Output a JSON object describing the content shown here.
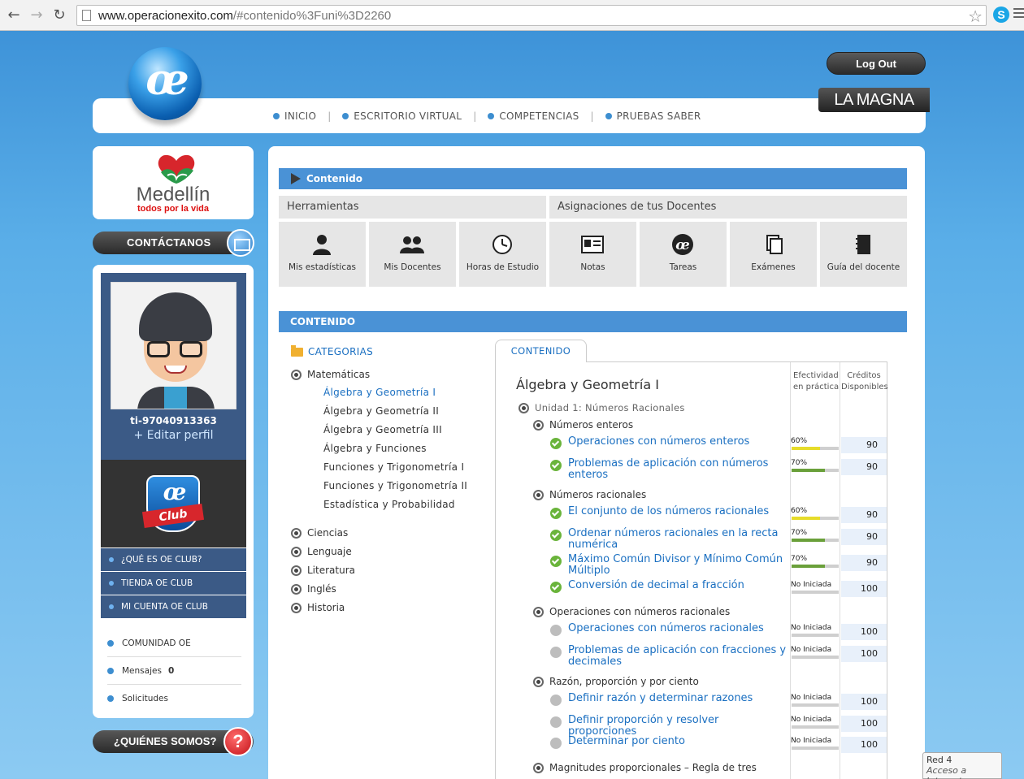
{
  "browser": {
    "url_host": "www.operacionexito.com",
    "url_path": "/#contenido%3Funi%3D2260"
  },
  "header": {
    "nav": [
      "INICIO",
      "ESCRITORIO VIRTUAL",
      "COMPETENCIAS",
      "PRUEBAS SABER"
    ],
    "logout_label": "Log Out",
    "badge": "LA MAGNA"
  },
  "sidebar": {
    "medellin_name": "Medellín",
    "medellin_sub": "todos por la vida",
    "contact_label": "CONTÁCTANOS",
    "user_id": "ti-97040913363",
    "edit_profile": "+ Editar perfil",
    "club_menu": [
      "¿QUÉ ES OE CLUB?",
      "TIENDA OE CLUB",
      "MI CUENTA OE CLUB"
    ],
    "community": {
      "community_label": "COMUNIDAD OE",
      "messages_label": "Mensajes",
      "messages_count": "0",
      "requests_label": "Solicitudes"
    },
    "about_label": "¿QUIÉNES SOMOS?"
  },
  "main": {
    "contenido_bar": "Contenido",
    "tools_header": "Herramientas",
    "assignments_header": "Asignaciones de tus Docentes",
    "tools": [
      "Mis estadísticas",
      "Mis Docentes",
      "Horas de Estudio",
      "Notas",
      "Tareas",
      "Exámenes",
      "Guía del docente"
    ],
    "contenido_section": "CONTENIDO",
    "categories_title": "CATEGORIAS",
    "categories": [
      "Matemáticas",
      "Ciencias",
      "Lenguaje",
      "Literatura",
      "Inglés",
      "Historia"
    ],
    "math_subcategories": [
      "Álgebra y Geometría I",
      "Álgebra y Geometría II",
      "Álgebra y Geometría III",
      "Álgebra y Funciones",
      "Funciones y Trigonometría I",
      "Funciones y Trigonometría II",
      "Estadística y Probabilidad"
    ],
    "tab_label": "CONTENIDO",
    "col_effectiveness": "Efectividad en práctica",
    "col_credits": "Créditos Disponibles",
    "course_title": "Álgebra y Geometría I",
    "unit_title": "Unidad 1: Números Racionales",
    "topics": [
      "Números enteros",
      "Números racionales",
      "Operaciones con números racionales",
      "Razón, proporción y por ciento",
      "Magnitudes proporcionales – Regla de tres"
    ],
    "lessons": [
      {
        "title": "Operaciones con números enteros",
        "status": "done",
        "effectiveness": "60%",
        "progress": 0.6,
        "credits": "90"
      },
      {
        "title": "Problemas de aplicación con números enteros",
        "status": "done",
        "effectiveness": "70%",
        "progress": 0.7,
        "credits": "90"
      },
      {
        "title": "El conjunto de los números racionales",
        "status": "done",
        "effectiveness": "60%",
        "progress": 0.6,
        "credits": "90"
      },
      {
        "title": "Ordenar números racionales en la recta numérica",
        "status": "done",
        "effectiveness": "70%",
        "progress": 0.7,
        "credits": "90"
      },
      {
        "title": "Máximo Común Divisor y Mínimo Común Múltiplo",
        "status": "done",
        "effectiveness": "70%",
        "progress": 0.7,
        "credits": "90"
      },
      {
        "title": "Conversión de decimal a fracción",
        "status": "done",
        "effectiveness": "No Iniciada",
        "progress": 0,
        "credits": "100"
      },
      {
        "title": "Operaciones con números racionales",
        "status": "todo",
        "effectiveness": "No Iniciada",
        "progress": 0,
        "credits": "100"
      },
      {
        "title": "Problemas de aplicación con fracciones y decimales",
        "status": "todo",
        "effectiveness": "No Iniciada",
        "progress": 0,
        "credits": "100"
      },
      {
        "title": "Definir razón y determinar razones",
        "status": "todo",
        "effectiveness": "No Iniciada",
        "progress": 0,
        "credits": "100"
      },
      {
        "title": "Definir proporción y resolver proporciones",
        "status": "todo",
        "effectiveness": "No Iniciada",
        "progress": 0,
        "credits": "100"
      },
      {
        "title": "Determinar por ciento",
        "status": "todo",
        "effectiveness": "No Iniciada",
        "progress": 0,
        "credits": "100"
      }
    ]
  },
  "status_popup": {
    "network": "Red  4",
    "access": "Acceso a Internet"
  },
  "colors": {
    "accent": "#4a92d6",
    "link": "#1a6fc1",
    "progress_low": "#e6dc2a",
    "progress_mid": "#6aa03a"
  }
}
